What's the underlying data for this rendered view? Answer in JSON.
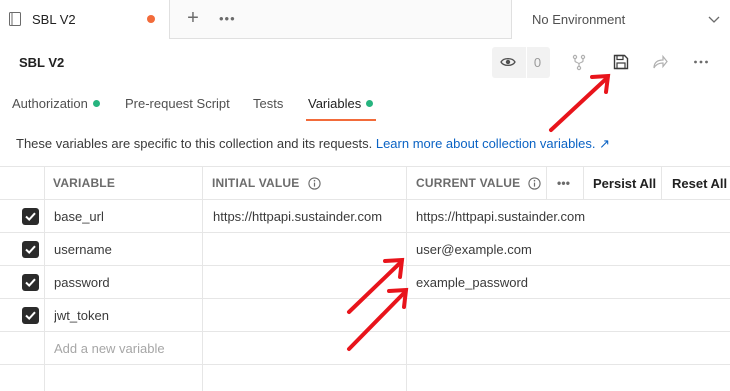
{
  "tabs": {
    "active_tab_title": "SBL V2",
    "add_tab_label": "+",
    "more_tabs_label": "•••"
  },
  "environment": {
    "selected": "No Environment"
  },
  "collection": {
    "title": "SBL V2",
    "watch_count": "0"
  },
  "subtabs": [
    {
      "label": "Authorization",
      "has_dot": true
    },
    {
      "label": "Pre-request Script",
      "has_dot": false
    },
    {
      "label": "Tests",
      "has_dot": false
    },
    {
      "label": "Variables",
      "has_dot": true,
      "active": true
    }
  ],
  "info": {
    "text": "These variables are specific to this collection and its requests. ",
    "link": "Learn more about collection variables. ↗"
  },
  "table": {
    "headers": {
      "variable": "VARIABLE",
      "initial": "INITIAL VALUE",
      "current": "CURRENT VALUE",
      "more": "•••",
      "persist_all": "Persist All",
      "reset_all": "Reset All"
    },
    "rows": [
      {
        "checked": true,
        "variable": "base_url",
        "initial": "https://httpapi.sustainder.com",
        "current": "https://httpapi.sustainder.com"
      },
      {
        "checked": true,
        "variable": "username",
        "initial": "",
        "current": "user@example.com"
      },
      {
        "checked": true,
        "variable": "password",
        "initial": "",
        "current": "example_password"
      },
      {
        "checked": true,
        "variable": "jwt_token",
        "initial": "",
        "current": ""
      }
    ],
    "new_variable_placeholder": "Add a new variable"
  },
  "colors": {
    "accent": "#f26b3a",
    "status_dot": "#26b47f",
    "link": "#0b63c4",
    "annotation_arrow": "#e8141b"
  },
  "icons": {
    "tab": "collection-icon",
    "watch": "eye-icon",
    "fork": "fork-icon",
    "save": "save-icon",
    "share": "share-icon",
    "more": "more-icon",
    "chevron": "chevron-down-icon"
  }
}
